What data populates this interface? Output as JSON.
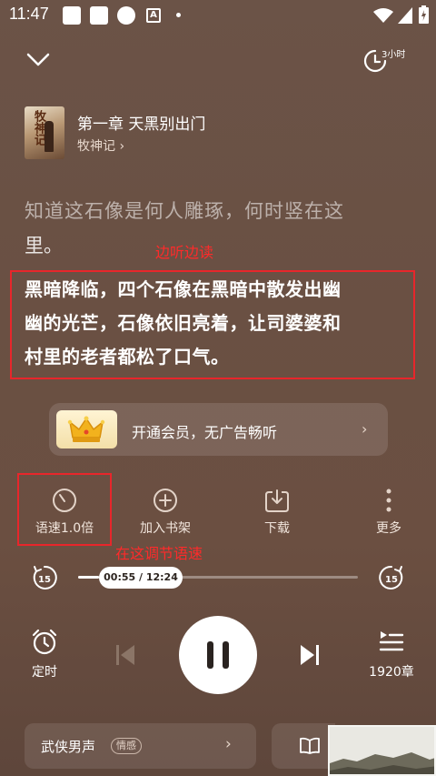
{
  "status_bar": {
    "time": "11:47"
  },
  "header": {
    "timer_label": "3小时"
  },
  "book": {
    "chapter_title": "第一章 天黑别出门",
    "author_link": "牧神记 ›",
    "cover_text": "牧神记"
  },
  "reading": {
    "faded_line": "知道这石像是何人雕琢，何时竖在这",
    "faded_line2": "里。",
    "annotation_top": "边听边读",
    "current_line1": "黑暗降临，四个石像在黑暗中散发出幽",
    "current_line2": "幽的光芒，石像依旧亮着，让司婆婆和",
    "current_line3": "村里的老者都松了口气。"
  },
  "vip_banner": {
    "text": "开通会员，无广告畅听",
    "arrow": "›"
  },
  "actions": {
    "speed_label": "语速1.0倍",
    "shelf_label": "加入书架",
    "download_label": "下载",
    "more_label": "更多",
    "annotation_speed": "在这调节语速"
  },
  "progress": {
    "time_display": "00:55 / 12:24",
    "fraction": 0.074,
    "rewind": "15",
    "forward": "15"
  },
  "playback": {
    "alarm_label": "定时",
    "chapters_label": "1920章"
  },
  "bottom": {
    "voice_label": "武侠男声",
    "voice_tag": "情感",
    "voice_arrow": "›"
  },
  "colors": {
    "accent_red": "#e8262b",
    "background": "#6a5043"
  }
}
